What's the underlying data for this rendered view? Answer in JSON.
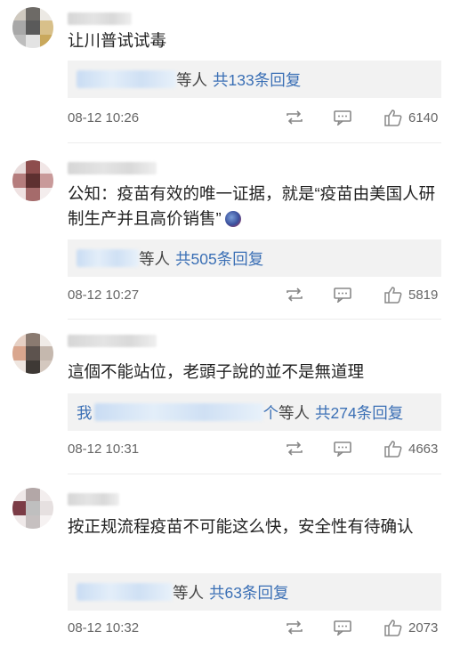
{
  "comments": [
    {
      "text": "让川普试试毒",
      "reply_people": "等人",
      "reply_count": "共133条回复",
      "time": "08-12 10:26",
      "likes": "6140"
    },
    {
      "text": "公知：疫苗有效的唯一证据，就是“疫苗由美国人研制生产并且高价销售”",
      "reply_people": "等人",
      "reply_count": "共505条回复",
      "time": "08-12 10:27",
      "likes": "5819"
    },
    {
      "text": "這個不能站位，老頭子說的並不是無道理",
      "reply_prefix": "我",
      "reply_suffix": "个",
      "reply_people": "等人",
      "reply_count": "共274条回复",
      "time": "08-12 10:31",
      "likes": "4663"
    },
    {
      "text": "按正规流程疫苗不可能这么快，安全性有待确认",
      "reply_people": "等人",
      "reply_count": "共63条回复",
      "time": "08-12 10:32",
      "likes": "2073"
    }
  ],
  "icons": {
    "repost": "repost-icon",
    "comment": "comment-icon",
    "like": "thumbs-up-icon"
  },
  "colors": {
    "link_blue": "#3a6fb5",
    "reply_bg": "#f2f2f2",
    "meta_gray": "#666666"
  }
}
